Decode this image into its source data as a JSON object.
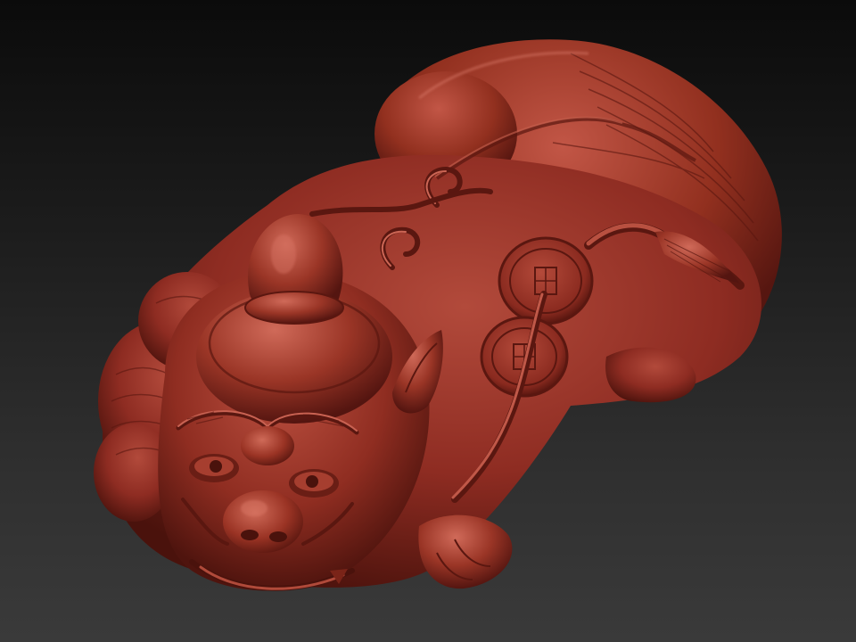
{
  "scene": {
    "subject": "pixiu-sculpt",
    "background_top_color": "#0b0b0b",
    "background_bottom_color": "#3a3a3a",
    "material_base_color": "#8e2c22",
    "material_highlight_color": "#c85a4a",
    "material_shadow_color": "#4a120c"
  }
}
